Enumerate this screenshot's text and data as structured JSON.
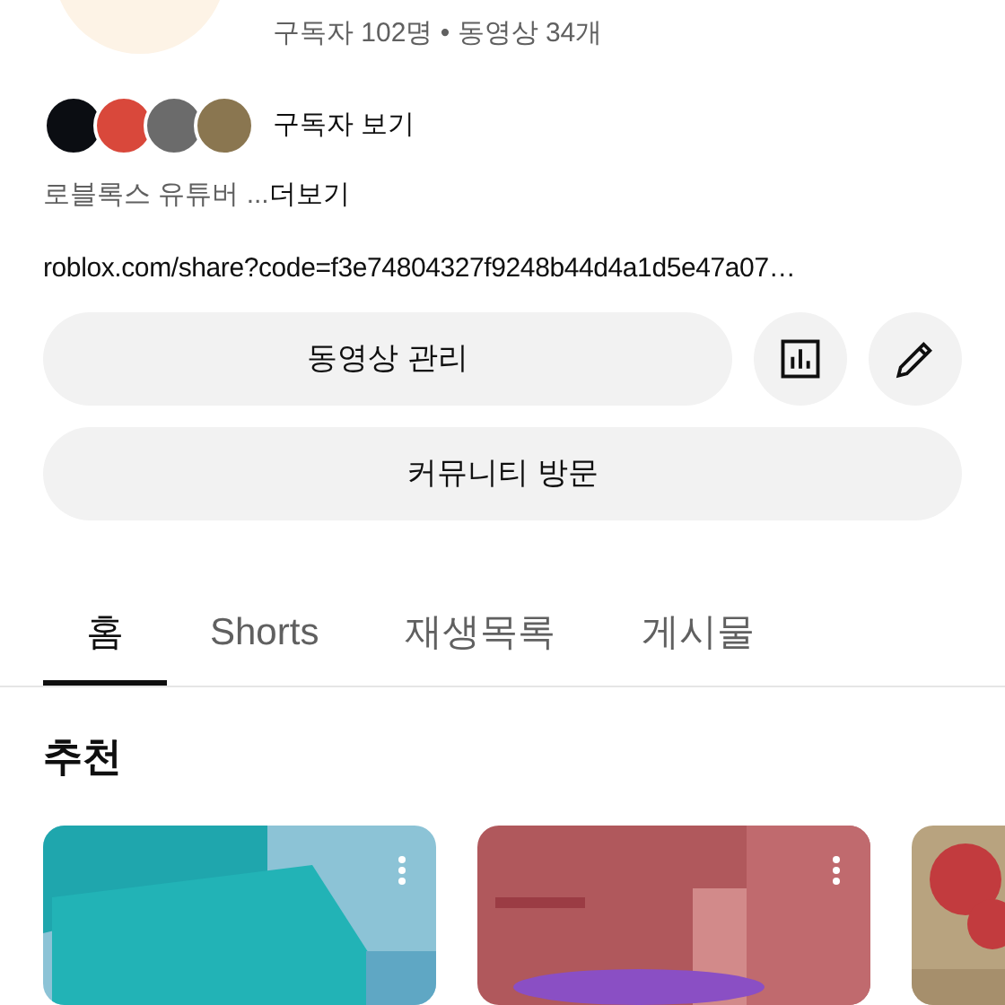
{
  "channel": {
    "stats": "구독자 102명 • 동영상 34개",
    "subscribers_link": "구독자 보기",
    "description": "로블록스 유튜버 ...",
    "more": "더보기",
    "link": "roblox.com/share?code=f3e74804327f9248b44d4a1d5e47a07…"
  },
  "buttons": [
    {
      "label": "동영상 관리",
      "kind": "wide"
    },
    {
      "kind": "analytics"
    },
    {
      "kind": "edit"
    },
    {
      "label": "커뮤니티 방문",
      "kind": "full"
    }
  ],
  "tabs": [
    {
      "label": "홈",
      "selected": true
    },
    {
      "label": "Shorts",
      "selected": false
    },
    {
      "label": "재생목록",
      "selected": false
    },
    {
      "label": "게시물",
      "selected": false
    }
  ],
  "section": {
    "title": "추천"
  }
}
